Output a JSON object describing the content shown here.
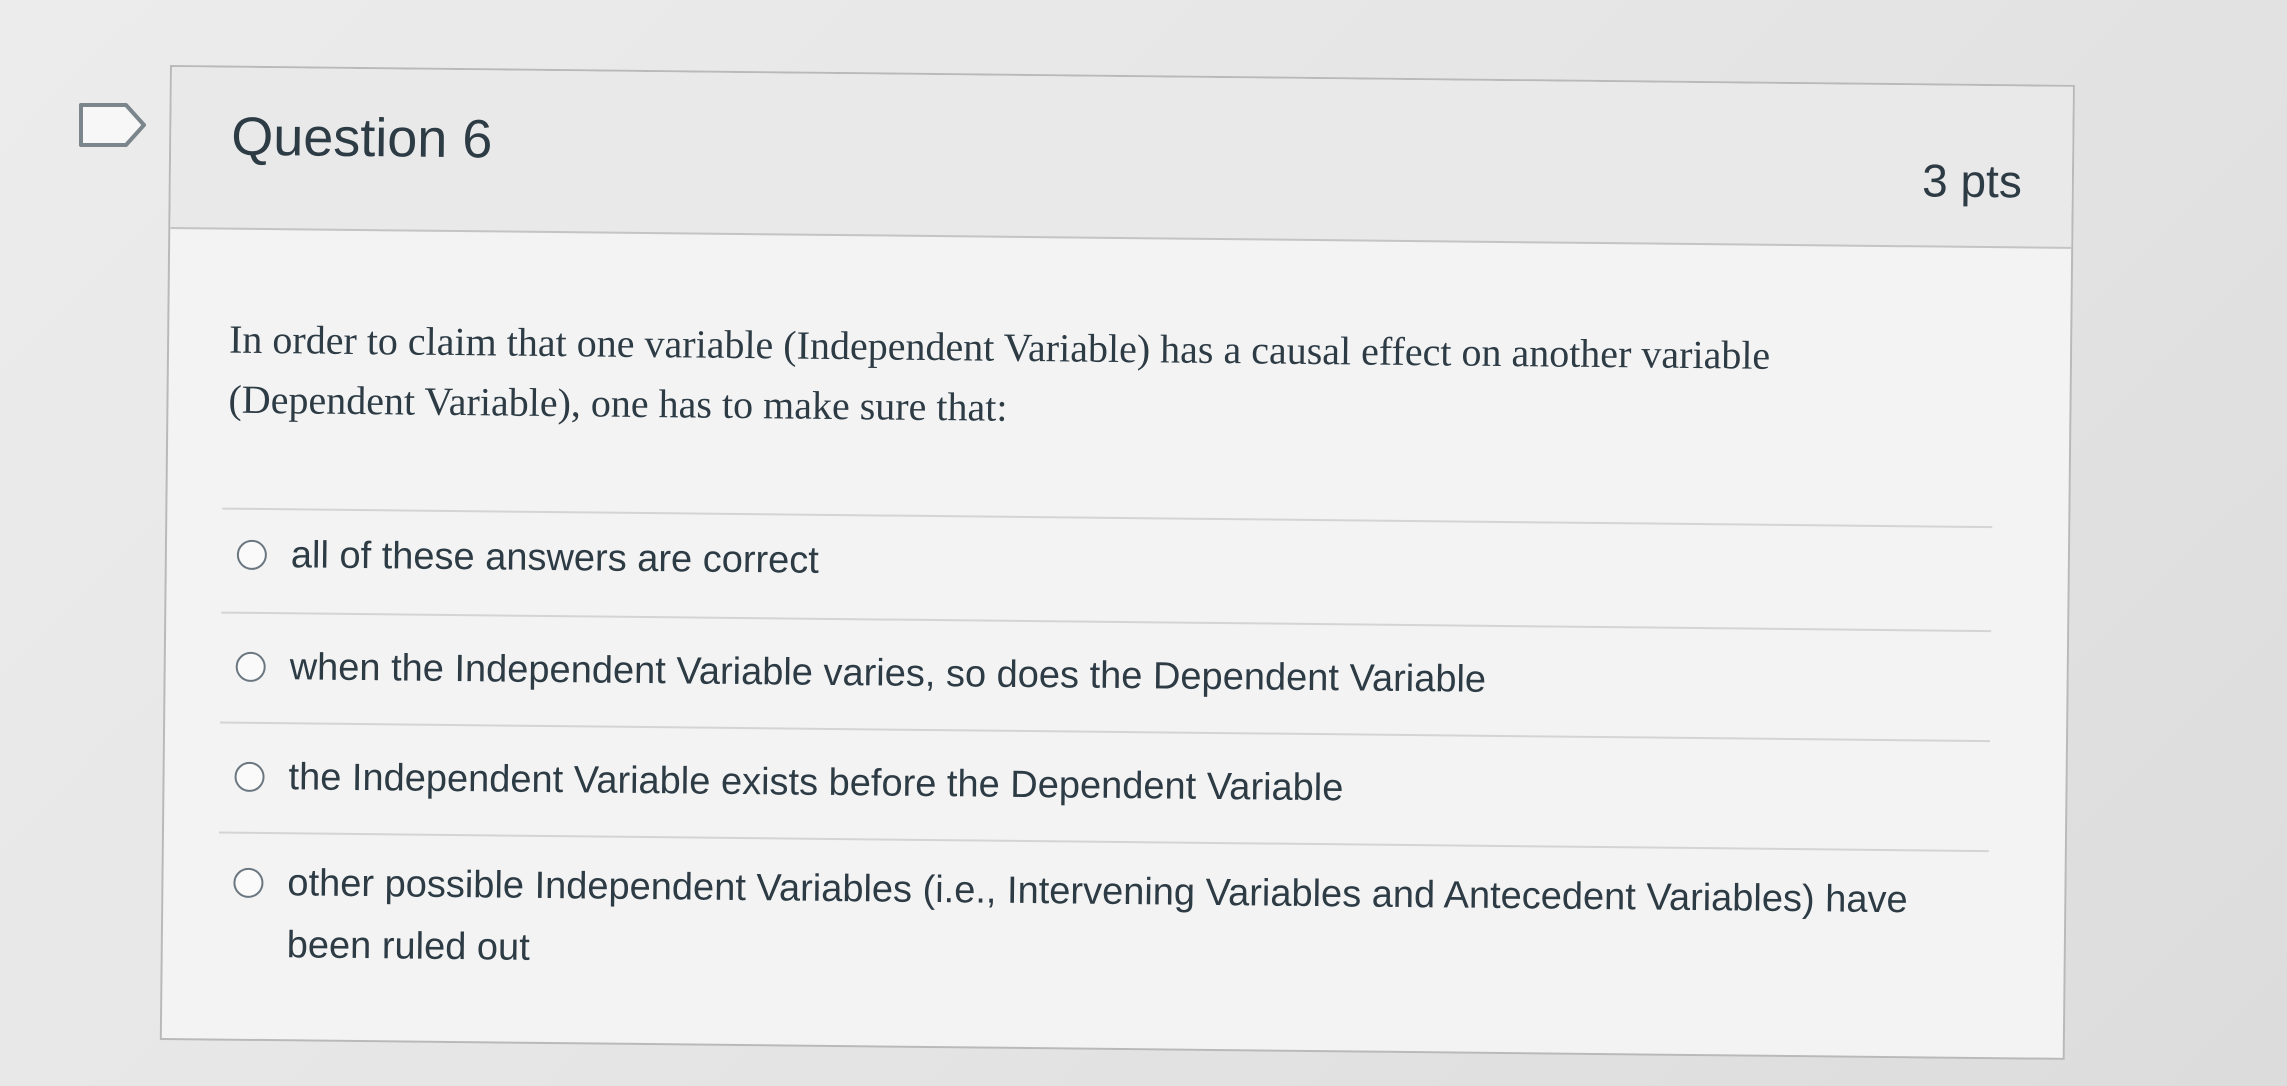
{
  "question": {
    "title": "Question 6",
    "points": "3 pts",
    "prompt": "In order to claim that one variable (Independent Variable) has a causal effect on another variable (Dependent Variable), one has to make sure that:"
  },
  "answers": [
    {
      "label": "all of these answers are correct"
    },
    {
      "label": "when the Independent Variable varies, so does the Dependent Variable"
    },
    {
      "label": "the Independent Variable exists before the Dependent Variable"
    },
    {
      "label": "other possible Independent Variables (i.e., Intervening Variables and Antecedent Variables) have been ruled out"
    }
  ],
  "icons": {
    "flag": "flag-icon"
  },
  "colors": {
    "text": "#2d3b45",
    "border": "#b9b9b9",
    "header_bg": "#e9e9e9"
  }
}
